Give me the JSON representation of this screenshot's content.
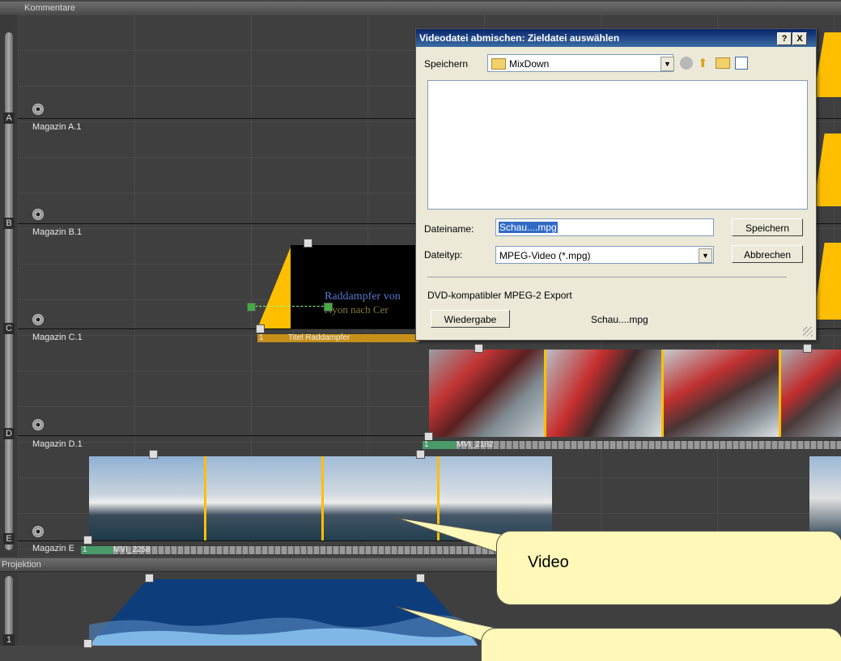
{
  "sections": {
    "comments": "Kommentare",
    "projection": "Projektion"
  },
  "tracks": [
    {
      "letter": "A",
      "label": "Magazin A.1"
    },
    {
      "letter": "B",
      "label": "Magazin B.1"
    },
    {
      "letter": "C",
      "label": "Magazin C.1"
    },
    {
      "letter": "D",
      "label": "Magazin D.1"
    },
    {
      "letter": "E",
      "label": "Magazin E"
    }
  ],
  "projection_track": {
    "letter": "1"
  },
  "clips": {
    "title_clip": {
      "num": "1",
      "name": "Titel Raddampfer",
      "overlay_text_1": "Raddampfer von",
      "overlay_text_2": "Nyon nach Cer"
    },
    "clip_d": {
      "num": "1",
      "name": "MVI_2182"
    },
    "clip_e": {
      "num": "1",
      "name": "MVI_2258"
    }
  },
  "dialog": {
    "title": "Videodatei abmischen: Zieldatei auswählen",
    "help_btn": "?",
    "close_btn": "X",
    "save_in_label": "Speichern",
    "folder": "MixDown",
    "filename_label": "Dateiname:",
    "filename_value": "Schau....mpg",
    "filetype_label": "Dateityp:",
    "filetype_value": "MPEG-Video (*.mpg)",
    "save_button": "Speichern",
    "cancel_button": "Abbrechen",
    "export_info": "DVD-kompatibler MPEG-2 Export",
    "play_button": "Wiedergabe",
    "play_file": "Schau....mpg"
  },
  "callouts": {
    "video": "Video"
  },
  "colors": {
    "accent_yellow": "#ffbf00",
    "audio_dark": "#0d3d7a",
    "audio_light": "#7fb7e6",
    "title_bar": "#0a246a"
  }
}
